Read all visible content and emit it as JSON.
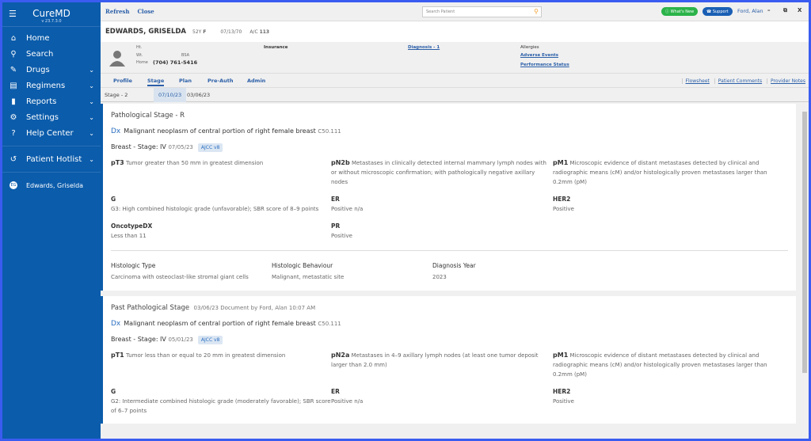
{
  "sidebar": {
    "brand": "CureMD",
    "version": "v 23.7.3.0",
    "items": [
      {
        "label": "Home",
        "icon": "home-icon",
        "glyph": "⌂",
        "chev": ""
      },
      {
        "label": "Search",
        "icon": "search-icon",
        "glyph": "⚲",
        "chev": ""
      },
      {
        "label": "Drugs",
        "icon": "pill-icon",
        "glyph": "✎",
        "chev": "⌄"
      },
      {
        "label": "Regimens",
        "icon": "clipboard-icon",
        "glyph": "▤",
        "chev": "⌄"
      },
      {
        "label": "Reports",
        "icon": "bar-chart-icon",
        "glyph": "▮",
        "chev": "⌄"
      },
      {
        "label": "Settings",
        "icon": "gear-icon",
        "glyph": "⚙",
        "chev": "⌄"
      },
      {
        "label": "Help Center",
        "icon": "help-icon",
        "glyph": "?",
        "chev": "⌄"
      }
    ],
    "hotlist": "Patient Hotlist",
    "hotlist_patient": "Edwards, Griselda",
    "hotlist_initials": "EG"
  },
  "topbar": {
    "refresh": "Refresh",
    "close": "Close",
    "search_placeholder": "Search Patient",
    "whats_new": "What's New",
    "support": "Support",
    "user": "Ford, Alan",
    "minimize": "–",
    "restore": "⧉",
    "close_window": "X"
  },
  "patient": {
    "name": "EDWARDS, GRISELDA",
    "age": "52Y",
    "sex": "F",
    "dob": "07/13/70",
    "ac_label": "A/C",
    "ac": "113",
    "ht_label": "Ht.",
    "wt_label": "Wt.",
    "bsa_label": "BSA",
    "home_label": "Home",
    "phone": "(704) 761-5416",
    "insurance_label": "Insurance",
    "diagnosis_link": "Diagnosis - 1",
    "allergies_label": "Allergies",
    "adverse_events": "Adverse Events",
    "performance_status": "Performance Status"
  },
  "tabs": [
    "Profile",
    "Stage",
    "Plan",
    "Pre-Auth",
    "Admin"
  ],
  "right_links": [
    "Flowsheet",
    "Patient Comments",
    "Provider Notes"
  ],
  "stage_bar": {
    "label": "Stage - 2",
    "dates": [
      "07/10/23",
      "03/06/23"
    ]
  },
  "cards": [
    {
      "title": "Pathological Stage - R",
      "meta": "",
      "dx_prefix": "Dx",
      "dx": "Malignant neoplasm of central portion of right female breast",
      "code": "C50.111",
      "stage": "Breast - Stage: IV",
      "stage_date": "07/05/23",
      "badge": "AJCC v8",
      "cells": [
        {
          "k": "pT3",
          "v": "Tumor greater than 50 mm in greatest dimension"
        },
        {
          "k": "pN2b",
          "v": "Metastases in clinically detected internal mammary lymph nodes with or without microscopic confirmation; with pathologically negative axillary nodes"
        },
        {
          "k": "pM1",
          "v": "Microscopic evidence of distant metastases detected by clinical and radiographic means (cM) and/or histologically proven metastases larger than 0.2mm (pM)"
        },
        {
          "k": "G",
          "v": "G3: High combined histologic grade (unfavorable); SBR score of 8–9 points"
        },
        {
          "k": "ER",
          "v": "Positive n/a"
        },
        {
          "k": "HER2",
          "v": "Positive"
        },
        {
          "k": "OncotypeDX",
          "v": "Less than 11"
        },
        {
          "k": "PR",
          "v": "Positive"
        }
      ],
      "extra": [
        {
          "k": "Histologic Type",
          "v": "Carcinoma with osteoclast-like stromal giant cells"
        },
        {
          "k": "Histologic Behaviour",
          "v": "Malignant, metastatic site"
        },
        {
          "k": "Diagnosis Year",
          "v": "2023"
        }
      ]
    },
    {
      "title": "Past Pathological Stage",
      "meta": "03/06/23  Document by  Ford, Alan  10:07 AM",
      "dx_prefix": "Dx",
      "dx": "Malignant neoplasm of central portion of right female breast",
      "code": "C50.111",
      "stage": "Breast - Stage: IV",
      "stage_date": "05/01/23",
      "badge": "AJCC v8",
      "cells": [
        {
          "k": "pT1",
          "v": "Tumor less than or equal to 20 mm in greatest dimension"
        },
        {
          "k": "pN2a",
          "v": "Metastases in 4–9 axillary lymph nodes (at least one tumor deposit larger than 2.0 mm)"
        },
        {
          "k": "pM1",
          "v": "Microscopic evidence of distant metastases detected by clinical and radiographic means (cM) and/or histologically proven metastases larger than 0.2mm (pM)"
        },
        {
          "k": "G",
          "v": "G2: Intermediate combined histologic grade (moderately favorable); SBR score of 6–7 points"
        },
        {
          "k": "ER",
          "v": "Positive n/a"
        },
        {
          "k": "HER2",
          "v": "Positive"
        }
      ],
      "extra": []
    }
  ]
}
